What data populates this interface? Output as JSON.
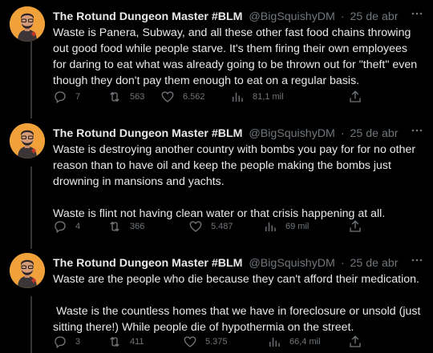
{
  "colors": {
    "background": "#000000",
    "text_primary": "#e7e9ea",
    "text_secondary": "#71767b",
    "avatar_bg": "#f0a13a"
  },
  "tweets": [
    {
      "author_name": "The Rotund Dungeon Master #BLM",
      "handle": "@BigSquishyDM",
      "separator": "·",
      "date": "25 de abr",
      "paragraphs": [
        "Waste is Panera, Subway, and all these other fast food chains throwing out good food while people starve. It's them firing their own employees for daring to eat what was already going to be thrown out for \"theft\" even though they don't pay them enough to eat on a regular basis."
      ],
      "replies": "7",
      "retweets": "563",
      "likes": "6.562",
      "views": "81,1 mil"
    },
    {
      "author_name": "The Rotund Dungeon Master #BLM",
      "handle": "@BigSquishyDM",
      "separator": "·",
      "date": "25 de abr",
      "paragraphs": [
        "Waste is destroying another country with bombs you pay for for no other reason than to have oil and keep the people making the bombs just drowning in mansions and yachts.",
        "Waste is flint not having clean water or that crisis happening at all."
      ],
      "replies": "4",
      "retweets": "366",
      "likes": "5.487",
      "views": "69 mil"
    },
    {
      "author_name": "The Rotund Dungeon Master #BLM",
      "handle": "@BigSquishyDM",
      "separator": "·",
      "date": "25 de abr",
      "paragraphs": [
        "Waste are the people who die because they can't afford their medication.",
        " Waste is the countless homes that we have in foreclosure or unsold (just sitting there!) While people die of hypothermia on the street."
      ],
      "replies": "3",
      "retweets": "411",
      "likes": "5.375",
      "views": "66,4 mil"
    }
  ],
  "icons": {
    "more": "more-horizontal-icon",
    "reply": "reply-icon",
    "retweet": "retweet-icon",
    "like": "heart-icon",
    "views": "views-chart-icon",
    "share": "share-icon"
  }
}
